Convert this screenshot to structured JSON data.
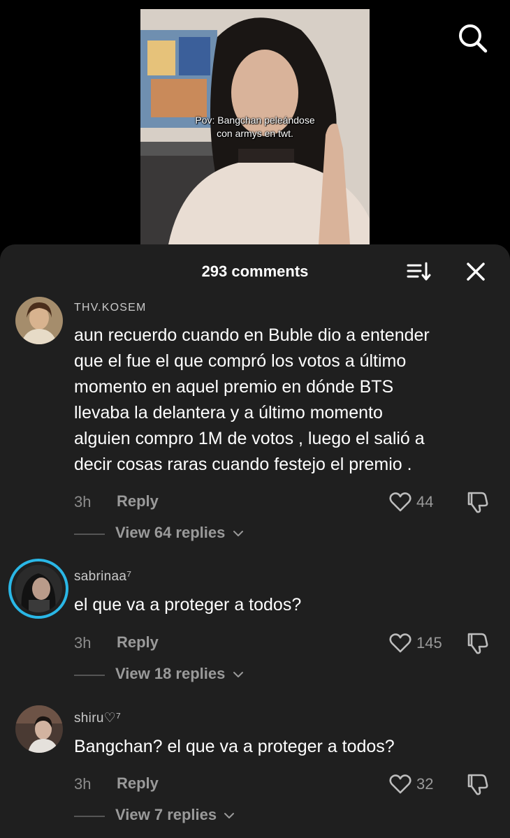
{
  "video": {
    "caption": "Pov: Bangchan peleándose\ncon armys en twt."
  },
  "search": {
    "icon": "search-icon"
  },
  "comments_sheet": {
    "count_label": "293 comments",
    "sort_icon": "sort-icon",
    "close_icon": "close-icon"
  },
  "comments": [
    {
      "username": "THV.KOSEM",
      "text": "aun recuerdo cuando en Buble dio a entender\nque el fue el que compró los votos a último\nmomento en aquel premio en dónde BTS\nllevaba la delantera y a último momento\nalguien compro 1M de votos , luego el salió a\ndecir cosas raras cuando festejo el premio .",
      "time": "3h",
      "reply_label": "Reply",
      "likes": "44",
      "view_replies": "View 64 replies"
    },
    {
      "username": "sabrinaa⁷",
      "text": "el que va a proteger a todos?",
      "time": "3h",
      "reply_label": "Reply",
      "likes": "145",
      "view_replies": "View 18 replies"
    },
    {
      "username": "shiru♡⁷",
      "text": "Bangchan? el que va a proteger a todos?",
      "time": "3h",
      "reply_label": "Reply",
      "likes": "32",
      "view_replies": "View 7 replies"
    }
  ],
  "colors": {
    "sheet_bg": "#1f1f1f",
    "story_ring": "#2ab7e6",
    "muted_text": "#9a9a9a"
  }
}
